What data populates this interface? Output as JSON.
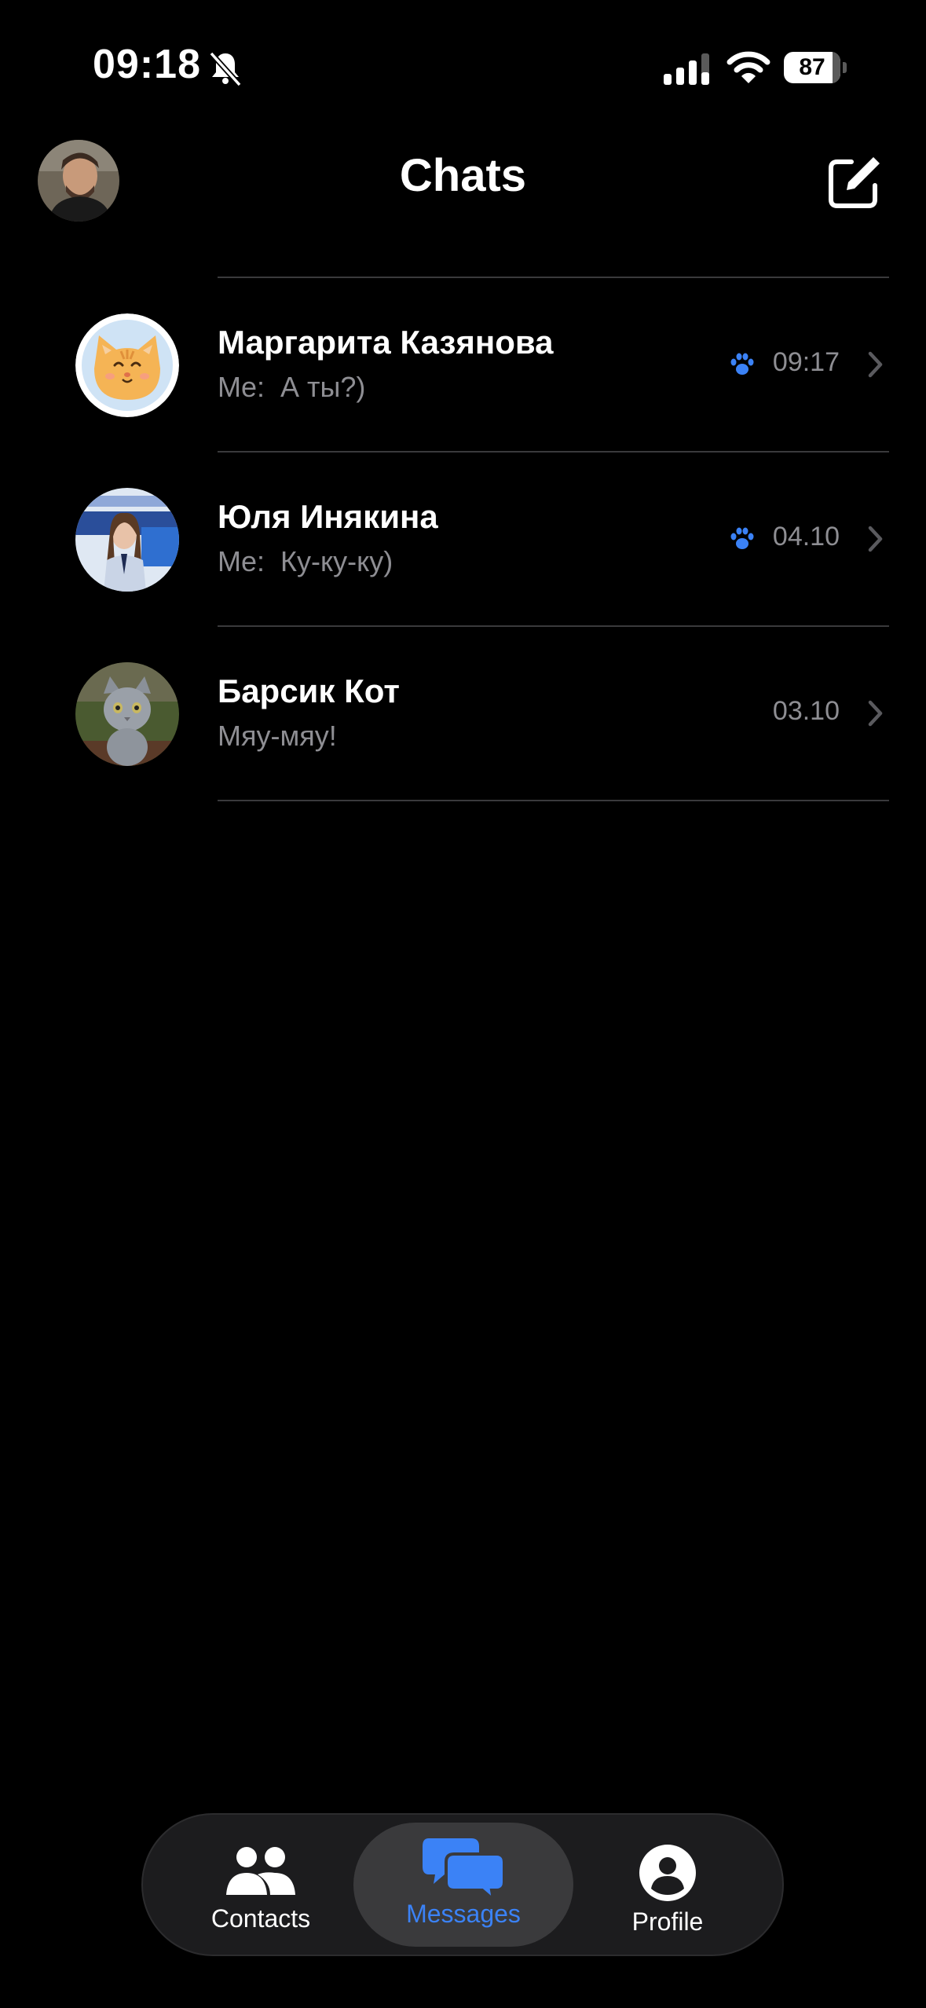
{
  "status_bar": {
    "time": "09:18",
    "battery": "87"
  },
  "header": {
    "title": "Chats"
  },
  "colors": {
    "accent": "#3b82f6",
    "background": "#000000",
    "secondary_text": "#8e8e93",
    "divider": "#3a3a3c"
  },
  "chats": [
    {
      "name": "Маргарита Казянова",
      "sender": "Me:",
      "preview": "А ты?)",
      "time": "09:17",
      "paw": true,
      "avatar": "orange-cat-avatar"
    },
    {
      "name": "Юля Инякина",
      "sender": "Me:",
      "preview": "Ку-ку-ку)",
      "time": "04.10",
      "paw": true,
      "avatar": "girl-photo-avatar"
    },
    {
      "name": "Барсик Кот",
      "sender": "",
      "preview": "Мяу-мяу!",
      "time": "03.10",
      "paw": false,
      "avatar": "grey-kitten-avatar"
    }
  ],
  "tabs": [
    {
      "label": "Contacts",
      "icon": "contacts-icon",
      "active": false
    },
    {
      "label": "Messages",
      "icon": "messages-icon",
      "active": true
    },
    {
      "label": "Profile",
      "icon": "profile-icon",
      "active": false
    }
  ]
}
